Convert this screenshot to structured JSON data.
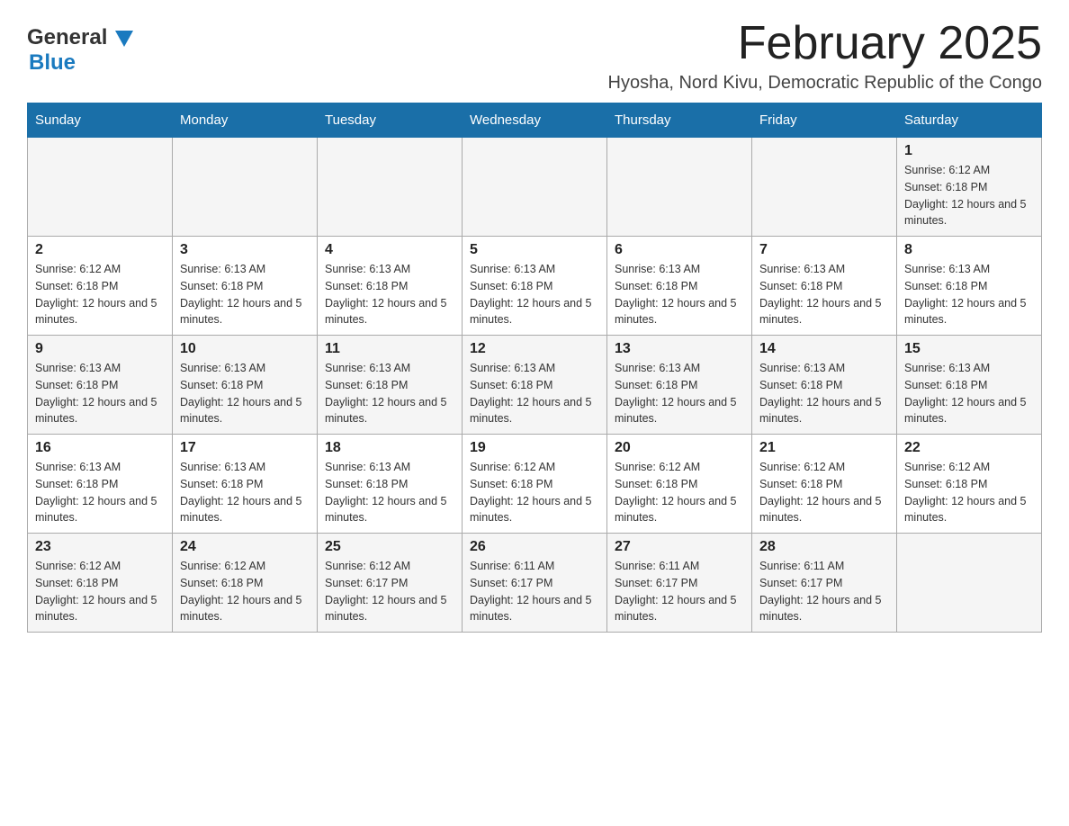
{
  "header": {
    "logo_general": "General",
    "logo_blue": "Blue",
    "month_title": "February 2025",
    "location": "Hyosha, Nord Kivu, Democratic Republic of the Congo"
  },
  "days_of_week": [
    "Sunday",
    "Monday",
    "Tuesday",
    "Wednesday",
    "Thursday",
    "Friday",
    "Saturday"
  ],
  "weeks": [
    [
      {
        "day": "",
        "info": ""
      },
      {
        "day": "",
        "info": ""
      },
      {
        "day": "",
        "info": ""
      },
      {
        "day": "",
        "info": ""
      },
      {
        "day": "",
        "info": ""
      },
      {
        "day": "",
        "info": ""
      },
      {
        "day": "1",
        "info": "Sunrise: 6:12 AM\nSunset: 6:18 PM\nDaylight: 12 hours and 5 minutes."
      }
    ],
    [
      {
        "day": "2",
        "info": "Sunrise: 6:12 AM\nSunset: 6:18 PM\nDaylight: 12 hours and 5 minutes."
      },
      {
        "day": "3",
        "info": "Sunrise: 6:13 AM\nSunset: 6:18 PM\nDaylight: 12 hours and 5 minutes."
      },
      {
        "day": "4",
        "info": "Sunrise: 6:13 AM\nSunset: 6:18 PM\nDaylight: 12 hours and 5 minutes."
      },
      {
        "day": "5",
        "info": "Sunrise: 6:13 AM\nSunset: 6:18 PM\nDaylight: 12 hours and 5 minutes."
      },
      {
        "day": "6",
        "info": "Sunrise: 6:13 AM\nSunset: 6:18 PM\nDaylight: 12 hours and 5 minutes."
      },
      {
        "day": "7",
        "info": "Sunrise: 6:13 AM\nSunset: 6:18 PM\nDaylight: 12 hours and 5 minutes."
      },
      {
        "day": "8",
        "info": "Sunrise: 6:13 AM\nSunset: 6:18 PM\nDaylight: 12 hours and 5 minutes."
      }
    ],
    [
      {
        "day": "9",
        "info": "Sunrise: 6:13 AM\nSunset: 6:18 PM\nDaylight: 12 hours and 5 minutes."
      },
      {
        "day": "10",
        "info": "Sunrise: 6:13 AM\nSunset: 6:18 PM\nDaylight: 12 hours and 5 minutes."
      },
      {
        "day": "11",
        "info": "Sunrise: 6:13 AM\nSunset: 6:18 PM\nDaylight: 12 hours and 5 minutes."
      },
      {
        "day": "12",
        "info": "Sunrise: 6:13 AM\nSunset: 6:18 PM\nDaylight: 12 hours and 5 minutes."
      },
      {
        "day": "13",
        "info": "Sunrise: 6:13 AM\nSunset: 6:18 PM\nDaylight: 12 hours and 5 minutes."
      },
      {
        "day": "14",
        "info": "Sunrise: 6:13 AM\nSunset: 6:18 PM\nDaylight: 12 hours and 5 minutes."
      },
      {
        "day": "15",
        "info": "Sunrise: 6:13 AM\nSunset: 6:18 PM\nDaylight: 12 hours and 5 minutes."
      }
    ],
    [
      {
        "day": "16",
        "info": "Sunrise: 6:13 AM\nSunset: 6:18 PM\nDaylight: 12 hours and 5 minutes."
      },
      {
        "day": "17",
        "info": "Sunrise: 6:13 AM\nSunset: 6:18 PM\nDaylight: 12 hours and 5 minutes."
      },
      {
        "day": "18",
        "info": "Sunrise: 6:13 AM\nSunset: 6:18 PM\nDaylight: 12 hours and 5 minutes."
      },
      {
        "day": "19",
        "info": "Sunrise: 6:12 AM\nSunset: 6:18 PM\nDaylight: 12 hours and 5 minutes."
      },
      {
        "day": "20",
        "info": "Sunrise: 6:12 AM\nSunset: 6:18 PM\nDaylight: 12 hours and 5 minutes."
      },
      {
        "day": "21",
        "info": "Sunrise: 6:12 AM\nSunset: 6:18 PM\nDaylight: 12 hours and 5 minutes."
      },
      {
        "day": "22",
        "info": "Sunrise: 6:12 AM\nSunset: 6:18 PM\nDaylight: 12 hours and 5 minutes."
      }
    ],
    [
      {
        "day": "23",
        "info": "Sunrise: 6:12 AM\nSunset: 6:18 PM\nDaylight: 12 hours and 5 minutes."
      },
      {
        "day": "24",
        "info": "Sunrise: 6:12 AM\nSunset: 6:18 PM\nDaylight: 12 hours and 5 minutes."
      },
      {
        "day": "25",
        "info": "Sunrise: 6:12 AM\nSunset: 6:17 PM\nDaylight: 12 hours and 5 minutes."
      },
      {
        "day": "26",
        "info": "Sunrise: 6:11 AM\nSunset: 6:17 PM\nDaylight: 12 hours and 5 minutes."
      },
      {
        "day": "27",
        "info": "Sunrise: 6:11 AM\nSunset: 6:17 PM\nDaylight: 12 hours and 5 minutes."
      },
      {
        "day": "28",
        "info": "Sunrise: 6:11 AM\nSunset: 6:17 PM\nDaylight: 12 hours and 5 minutes."
      },
      {
        "day": "",
        "info": ""
      }
    ]
  ]
}
